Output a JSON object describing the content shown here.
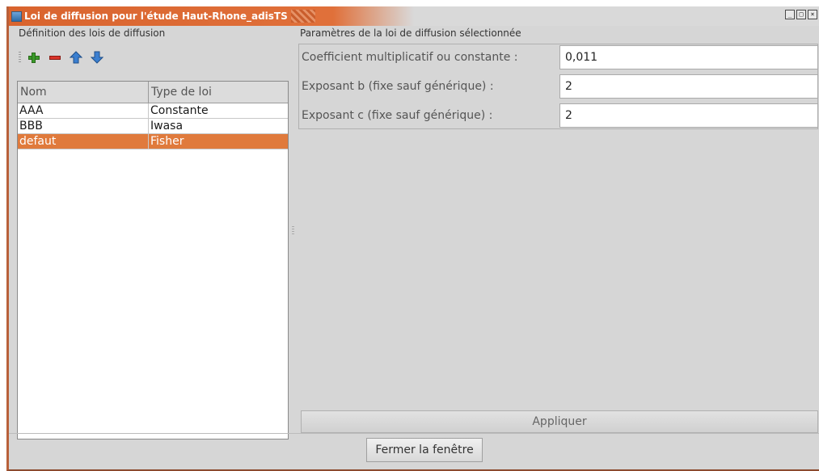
{
  "window": {
    "title": "Loi de diffusion pour l'étude Haut-Rhone_adisTS",
    "controls": [
      "_",
      "□",
      "×"
    ]
  },
  "left": {
    "section_title": "Définition des lois de diffusion",
    "toolbar": {
      "icons": [
        "add-icon",
        "remove-icon",
        "move-up-icon",
        "move-down-icon"
      ]
    },
    "table": {
      "headers": [
        "Nom",
        "Type de loi"
      ],
      "rows": [
        {
          "name": "AAA",
          "type": "Constante"
        },
        {
          "name": "BBB",
          "type": "Iwasa"
        },
        {
          "name": "defaut",
          "type": "Fisher",
          "selected": true
        }
      ]
    }
  },
  "right": {
    "section_title": "Paramètres de la loi de diffusion sélectionnée",
    "fields": [
      {
        "label": "Coefficient multiplicatif ou constante :",
        "value": "0,011"
      },
      {
        "label": "Exposant b (fixe sauf générique) :",
        "value": "2"
      },
      {
        "label": "Exposant c (fixe sauf générique) :",
        "value": "2"
      }
    ],
    "apply_label": "Appliquer"
  },
  "footer": {
    "close_label": "Fermer la fenêtre"
  },
  "colors": {
    "selection": "#e07a3c",
    "titlebar": "#d9642e",
    "add": "#3a9a2a",
    "remove": "#d9342a",
    "arrows": "#3b7fd0"
  }
}
